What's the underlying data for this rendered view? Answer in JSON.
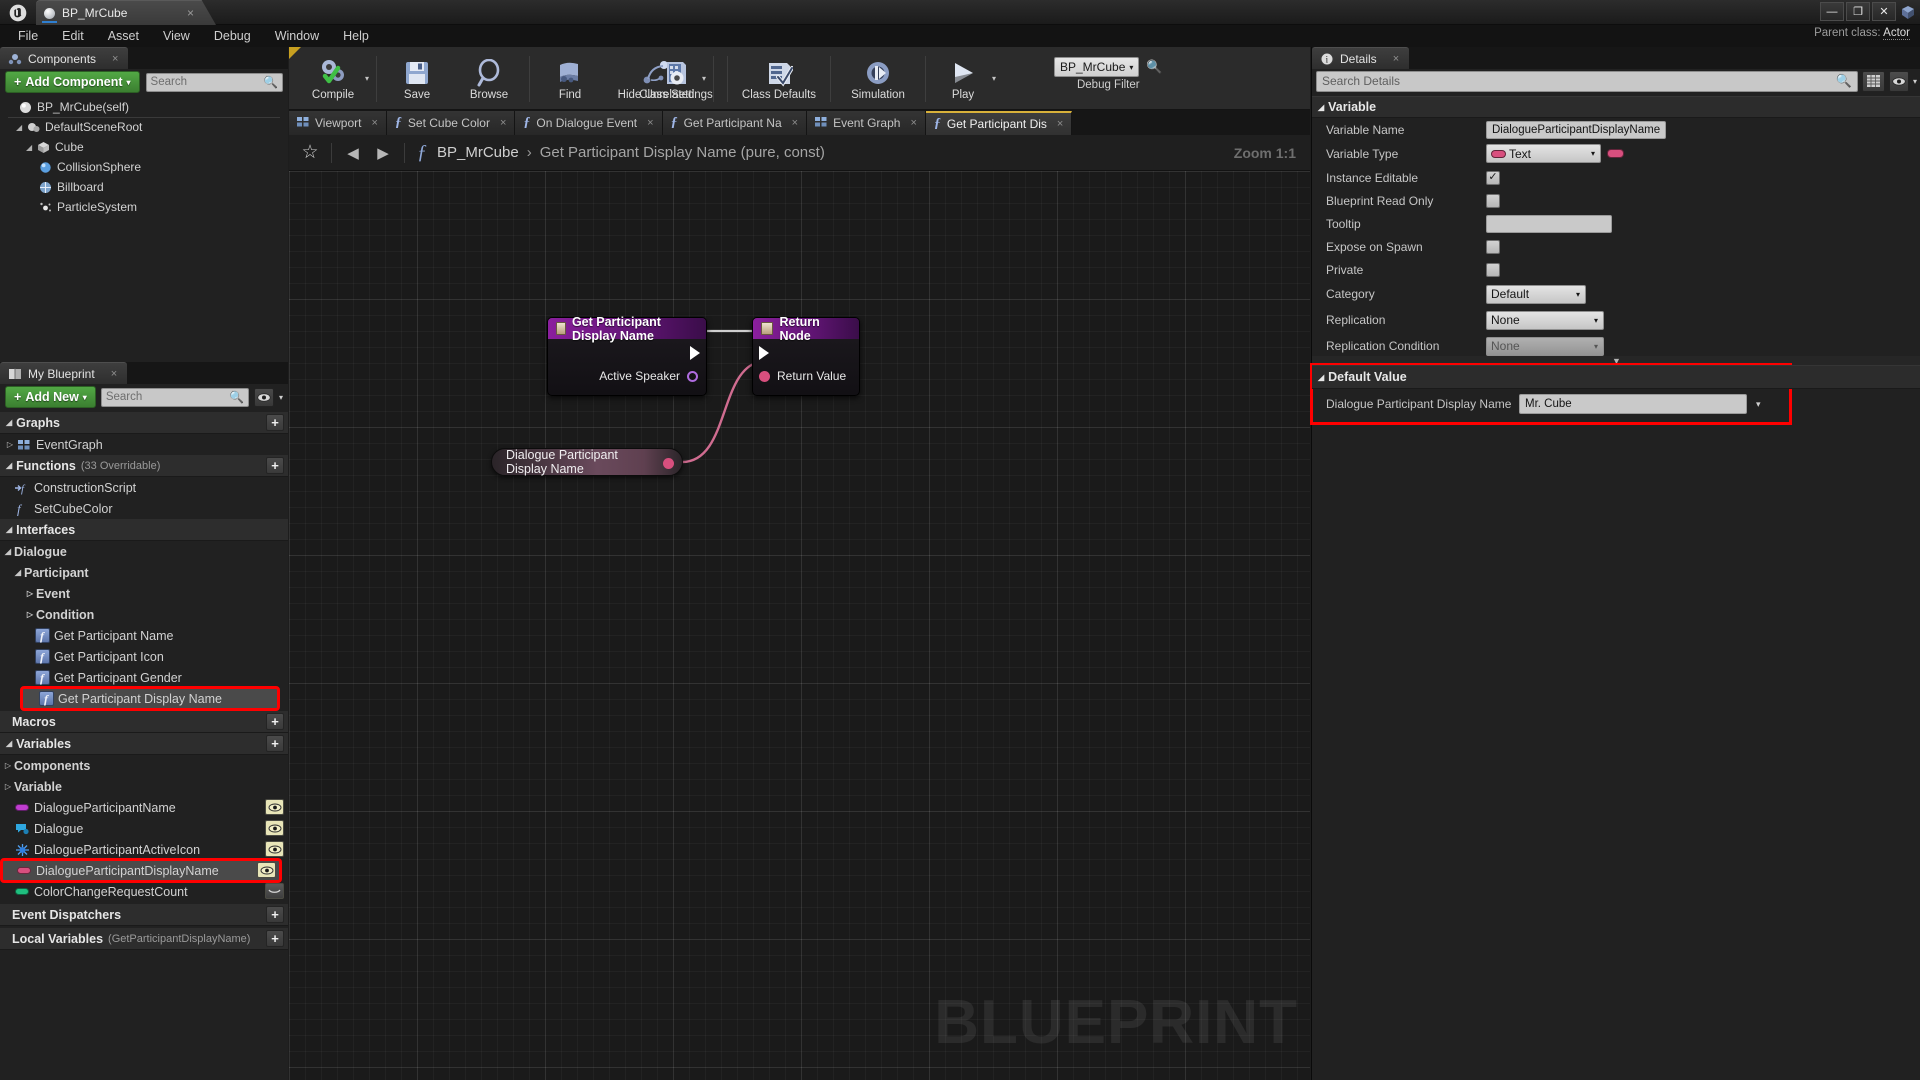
{
  "window": {
    "tab_title": "BP_MrCube",
    "tab_close": "×",
    "minimize": "—",
    "maximize": "❐",
    "close": "✕",
    "logo": "ue-logo"
  },
  "menubar": {
    "items": [
      "File",
      "Edit",
      "Asset",
      "View",
      "Debug",
      "Window",
      "Help"
    ]
  },
  "parent_class": {
    "label": "Parent class:",
    "value": "Actor"
  },
  "components": {
    "tab_label": "Components",
    "tab_close": "×",
    "add_button": "Add Component",
    "add_caret": "▾",
    "search_placeholder": "Search",
    "tree": [
      {
        "label": "BP_MrCube(self)",
        "indent": 0,
        "arrow": "",
        "icon": "sphere-icon"
      },
      {
        "label": "DefaultSceneRoot",
        "indent": 1,
        "arrow": "◢",
        "icon": "scene-root-icon"
      },
      {
        "label": "Cube",
        "indent": 2,
        "arrow": "◢",
        "icon": "cube-icon"
      },
      {
        "label": "CollisionSphere",
        "indent": 3,
        "arrow": "",
        "icon": "collision-sphere-icon"
      },
      {
        "label": "Billboard",
        "indent": 3,
        "arrow": "",
        "icon": "billboard-icon"
      },
      {
        "label": "ParticleSystem",
        "indent": 3,
        "arrow": "",
        "icon": "particle-system-icon"
      }
    ]
  },
  "myblueprint": {
    "tab_label": "My Blueprint",
    "tab_close": "×",
    "add_button": "Add New",
    "add_caret": "▾",
    "search_placeholder": "Search",
    "sections": {
      "graphs": {
        "label": "Graphs",
        "plus": "+"
      },
      "functions": {
        "label": "Functions",
        "sub": "(33 Overridable)",
        "plus": "+"
      },
      "interfaces": {
        "label": "Interfaces"
      },
      "macros": {
        "label": "Macros",
        "plus": "+"
      },
      "variables": {
        "label": "Variables",
        "plus": "+"
      },
      "event_dispatchers": {
        "label": "Event Dispatchers",
        "plus": "+"
      },
      "local_variables": {
        "label": "Local Variables",
        "sub": "(GetParticipantDisplayName)",
        "plus": "+"
      }
    },
    "graphs_items": [
      {
        "label": "EventGraph",
        "icon": "event-graph-icon",
        "arrow": "▷"
      }
    ],
    "functions_items": [
      {
        "label": "ConstructionScript",
        "icon": "construction-script-icon"
      },
      {
        "label": "SetCubeColor",
        "icon": "function-icon"
      }
    ],
    "interface_tree": [
      {
        "label": "Dialogue",
        "indent": 0,
        "arrow": "◢",
        "bold": true
      },
      {
        "label": "Participant",
        "indent": 1,
        "arrow": "◢",
        "bold": true
      },
      {
        "label": "Event",
        "indent": 2,
        "arrow": "▷",
        "bold": true
      },
      {
        "label": "Condition",
        "indent": 2,
        "arrow": "▷",
        "bold": true
      },
      {
        "label": "Get Participant Name",
        "indent": 3,
        "icon": "function-icon"
      },
      {
        "label": "Get Participant Icon",
        "indent": 3,
        "icon": "function-icon"
      },
      {
        "label": "Get Participant Gender",
        "indent": 3,
        "icon": "function-icon"
      },
      {
        "label": "Get Participant Display Name",
        "indent": 3,
        "icon": "function-icon",
        "highlighted": true
      }
    ],
    "variable_groups": [
      {
        "label": "Components",
        "arrow": "▷"
      },
      {
        "label": "Variable",
        "arrow": "▷"
      }
    ],
    "variables": [
      {
        "label": "DialogueParticipantName",
        "color": "#c03dd0",
        "icon": "text-variable-icon",
        "eye": true
      },
      {
        "label": "Dialogue",
        "color": "#2fa8e0",
        "icon": "dialogue-asset-icon",
        "eye": true
      },
      {
        "label": "DialogueParticipantActiveIcon",
        "color": "#2f7fe0",
        "icon": "texture-variable-icon",
        "eye": true
      },
      {
        "label": "DialogueParticipantDisplayName",
        "color": "#d84f7e",
        "icon": "text-variable-icon",
        "eye": true,
        "highlighted": true,
        "selected": true
      },
      {
        "label": "ColorChangeRequestCount",
        "color": "#1fbf7f",
        "icon": "int-variable-icon",
        "eye": false
      }
    ]
  },
  "toolbar": {
    "buttons": [
      {
        "label": "Compile",
        "icon": "compile-icon",
        "caret": true
      },
      {
        "label": "Save",
        "icon": "save-icon",
        "caret": false
      },
      {
        "label": "Browse",
        "icon": "browse-icon",
        "caret": false
      },
      {
        "label": "Find",
        "icon": "find-icon",
        "caret": false
      },
      {
        "label": "Hide Unrelated",
        "icon": "hide-unrelated-icon",
        "caret": true
      },
      {
        "label": "Class Settings",
        "icon": "class-settings-icon",
        "caret": false
      },
      {
        "label": "Class Defaults",
        "icon": "class-defaults-icon",
        "caret": false
      },
      {
        "label": "Simulation",
        "icon": "simulation-icon",
        "caret": false
      },
      {
        "label": "Play",
        "icon": "play-icon",
        "caret": true
      }
    ],
    "debug_filter": {
      "value": "BP_MrCube",
      "caret": "▾",
      "label": "Debug Filter",
      "search_icon": "magnifier-icon"
    }
  },
  "graph_tabs": [
    {
      "label": "Viewport",
      "icon": "viewport-icon",
      "close": "×",
      "active": false
    },
    {
      "label": "Set Cube Color",
      "icon": "function-tab-icon",
      "close": "×",
      "active": false
    },
    {
      "label": "On Dialogue Event",
      "icon": "function-tab-icon",
      "close": "×",
      "active": false
    },
    {
      "label": "Get Participant Na",
      "icon": "function-tab-icon",
      "close": "×",
      "active": false
    },
    {
      "label": "Event Graph",
      "icon": "viewport-icon",
      "close": "×",
      "active": false
    },
    {
      "label": "Get Participant Dis",
      "icon": "function-tab-icon",
      "close": "×",
      "active": true
    }
  ],
  "breadcrumb": {
    "star": "☆",
    "back": "◀",
    "forward": "▶",
    "fx": "ƒ",
    "root": "BP_MrCube",
    "chevron": "›",
    "current": "Get Participant Display Name (pure, const)",
    "zoom": "Zoom 1:1"
  },
  "graph": {
    "watermark": "BLUEPRINT",
    "nodes": [
      {
        "id": "entry",
        "title": "Get Participant Display Name",
        "pins": [
          {
            "label": "Active Speaker",
            "type": "object-ref"
          }
        ]
      },
      {
        "id": "return",
        "title": "Return Node",
        "pins": [
          {
            "label": "Return Value",
            "type": "text"
          }
        ]
      }
    ],
    "getter": {
      "label": "Dialogue Participant Display Name"
    }
  },
  "details": {
    "tab_label": "Details",
    "tab_close": "×",
    "search_placeholder": "Search Details",
    "category_variable": "Variable",
    "category_default_value": "Default Value",
    "rows": [
      {
        "name": "Variable Name",
        "type": "text",
        "value": "DialogueParticipantDisplayName"
      },
      {
        "name": "Variable Type",
        "type": "combo-type",
        "value": "Text",
        "pill_color": "#d84f7e"
      },
      {
        "name": "Instance Editable",
        "type": "checkbox",
        "checked": true
      },
      {
        "name": "Blueprint Read Only",
        "type": "checkbox",
        "checked": false
      },
      {
        "name": "Tooltip",
        "type": "text",
        "value": ""
      },
      {
        "name": "Expose on Spawn",
        "type": "checkbox",
        "checked": false
      },
      {
        "name": "Private",
        "type": "checkbox",
        "checked": false
      },
      {
        "name": "Category",
        "type": "combo",
        "value": "Default"
      },
      {
        "name": "Replication",
        "type": "combo",
        "value": "None"
      },
      {
        "name": "Replication Condition",
        "type": "combo-disabled",
        "value": "None"
      }
    ],
    "default_value_row": {
      "name": "Dialogue Participant Display Name",
      "value": "Mr. Cube",
      "caret": "▾"
    }
  },
  "colors": {
    "highlight_red": "#ff0000",
    "accent_green": "#52a845",
    "node_purple": "#8b1f9e",
    "text_pin_pink": "#d84f7e",
    "tab_accent_yellow": "#d8b13a"
  }
}
